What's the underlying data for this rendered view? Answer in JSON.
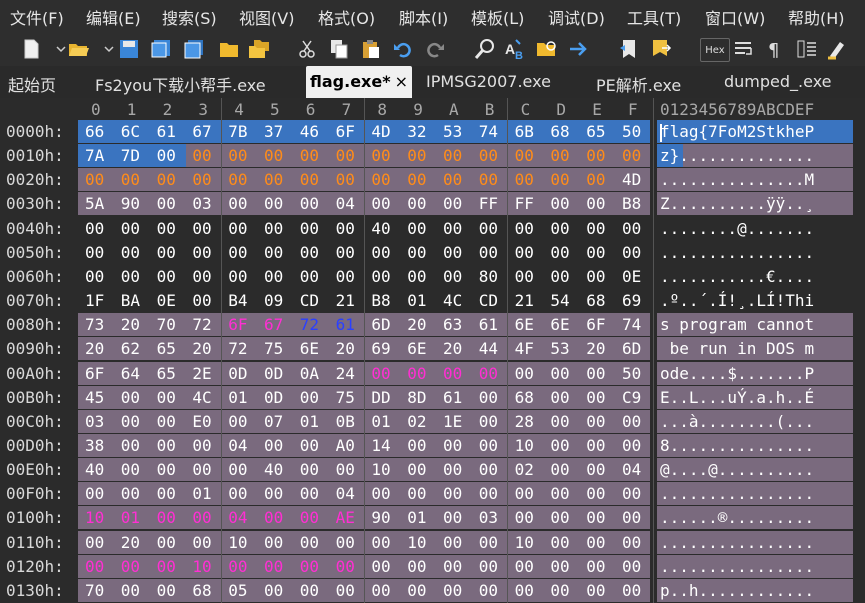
{
  "menu": [
    "文件(F)",
    "编辑(E)",
    "搜索(S)",
    "视图(V)",
    "格式(O)",
    "脚本(I)",
    "模板(L)",
    "调试(D)",
    "工具(T)",
    "窗口(W)",
    "帮助(H)"
  ],
  "toolbar": {
    "icons": [
      "new-file-icon",
      "dropdown-icon",
      "open-folder-icon",
      "dropdown-icon",
      "save-icon",
      "save-as-icon",
      "save-all-icon",
      "folder-icon",
      "folder-stack-icon",
      "cut-icon",
      "copy-icon",
      "paste-icon",
      "undo-icon",
      "redo-icon",
      "find-icon",
      "replace-icon",
      "find-in-files-icon",
      "goto-icon",
      "bookmark-icon",
      "bookmark-next-icon",
      "hex-mode-icon",
      "wrap-icon",
      "pilcrow-icon",
      "columns-icon",
      "highlight-icon"
    ],
    "hex_label": "Hex"
  },
  "tabs": [
    "起始页",
    "Fs2you下载小帮手.exe",
    "flag.exe*",
    "IPMSG2007.exe",
    "PE解析.exe",
    "dumped_.exe"
  ],
  "active_tab": 2,
  "close_glyph": "×",
  "column_header": {
    "hex": [
      "0",
      "1",
      "2",
      "3",
      "4",
      "5",
      "6",
      "7",
      "8",
      "9",
      "A",
      "B",
      "C",
      "D",
      "E",
      "F"
    ],
    "ascii": "0123456789ABCDEF"
  },
  "colors": {
    "selection": "#3a74c0",
    "struct": "#7a6a7e",
    "dark_row": "#2b2b2b",
    "zero_orange": "#ff8c1a",
    "magenta": "#ff2fd3",
    "blue": "#2a40ff",
    "white": "#ffffff"
  },
  "rows": [
    {
      "addr": "0000h:",
      "bytes": [
        "66",
        "6C",
        "61",
        "67",
        "7B",
        "37",
        "46",
        "6F",
        "4D",
        "32",
        "53",
        "74",
        "6B",
        "68",
        "65",
        "50"
      ],
      "ascii": "flag{7FoM2StkheP",
      "bg": "selection",
      "colors": {}
    },
    {
      "addr": "0010h:",
      "bytes": [
        "7A",
        "7D",
        "00",
        "00",
        "00",
        "00",
        "00",
        "00",
        "00",
        "00",
        "00",
        "00",
        "00",
        "00",
        "00",
        "00"
      ],
      "ascii": "z}..............",
      "bg": "mixed",
      "colors": {
        "3": "orange",
        "4": "orange",
        "5": "orange",
        "6": "orange",
        "7": "orange",
        "8": "orange",
        "9": "orange",
        "10": "orange",
        "11": "orange",
        "12": "orange",
        "13": "orange",
        "14": "orange",
        "15": "orange"
      }
    },
    {
      "addr": "0020h:",
      "bytes": [
        "00",
        "00",
        "00",
        "00",
        "00",
        "00",
        "00",
        "00",
        "00",
        "00",
        "00",
        "00",
        "00",
        "00",
        "00",
        "4D"
      ],
      "ascii": "...............M",
      "bg": "struct",
      "colors": {
        "0": "orange",
        "1": "orange",
        "2": "orange",
        "3": "orange",
        "4": "orange",
        "5": "orange",
        "6": "orange",
        "7": "orange",
        "8": "orange",
        "9": "orange",
        "10": "orange",
        "11": "orange",
        "12": "orange",
        "13": "orange",
        "14": "orange"
      }
    },
    {
      "addr": "0030h:",
      "bytes": [
        "5A",
        "90",
        "00",
        "03",
        "00",
        "00",
        "00",
        "04",
        "00",
        "00",
        "00",
        "FF",
        "FF",
        "00",
        "00",
        "B8"
      ],
      "ascii": "Z..........ÿÿ..¸",
      "bg": "struct",
      "colors": {}
    },
    {
      "addr": "0040h:",
      "bytes": [
        "00",
        "00",
        "00",
        "00",
        "00",
        "00",
        "00",
        "00",
        "40",
        "00",
        "00",
        "00",
        "00",
        "00",
        "00",
        "00"
      ],
      "ascii": "........@.......",
      "bg": "dark",
      "colors": {}
    },
    {
      "addr": "0050h:",
      "bytes": [
        "00",
        "00",
        "00",
        "00",
        "00",
        "00",
        "00",
        "00",
        "00",
        "00",
        "00",
        "00",
        "00",
        "00",
        "00",
        "00"
      ],
      "ascii": "................",
      "bg": "dark",
      "colors": {}
    },
    {
      "addr": "0060h:",
      "bytes": [
        "00",
        "00",
        "00",
        "00",
        "00",
        "00",
        "00",
        "00",
        "00",
        "00",
        "00",
        "80",
        "00",
        "00",
        "00",
        "0E"
      ],
      "ascii": "...........€....",
      "bg": "dark",
      "colors": {}
    },
    {
      "addr": "0070h:",
      "bytes": [
        "1F",
        "BA",
        "0E",
        "00",
        "B4",
        "09",
        "CD",
        "21",
        "B8",
        "01",
        "4C",
        "CD",
        "21",
        "54",
        "68",
        "69"
      ],
      "ascii": ".º..´.Í!¸.LÍ!Thi",
      "bg": "dark",
      "colors": {}
    },
    {
      "addr": "0080h:",
      "bytes": [
        "73",
        "20",
        "70",
        "72",
        "6F",
        "67",
        "72",
        "61",
        "6D",
        "20",
        "63",
        "61",
        "6E",
        "6E",
        "6F",
        "74"
      ],
      "ascii": "s program cannot",
      "bg": "struct",
      "colors": {
        "4": "magenta",
        "5": "magenta",
        "6": "blue",
        "7": "blue"
      }
    },
    {
      "addr": "0090h:",
      "bytes": [
        "20",
        "62",
        "65",
        "20",
        "72",
        "75",
        "6E",
        "20",
        "69",
        "6E",
        "20",
        "44",
        "4F",
        "53",
        "20",
        "6D"
      ],
      "ascii": " be run in DOS m",
      "bg": "struct",
      "colors": {}
    },
    {
      "addr": "00A0h:",
      "bytes": [
        "6F",
        "64",
        "65",
        "2E",
        "0D",
        "0D",
        "0A",
        "24",
        "00",
        "00",
        "00",
        "00",
        "00",
        "00",
        "00",
        "50"
      ],
      "ascii": "ode....$.......P",
      "bg": "struct",
      "colors": {
        "8": "magenta",
        "9": "magenta",
        "10": "magenta",
        "11": "magenta"
      }
    },
    {
      "addr": "00B0h:",
      "bytes": [
        "45",
        "00",
        "00",
        "4C",
        "01",
        "0D",
        "00",
        "75",
        "DD",
        "8D",
        "61",
        "00",
        "68",
        "00",
        "00",
        "C9"
      ],
      "ascii": "E..L...uÝ.a.h..É",
      "bg": "struct",
      "colors": {}
    },
    {
      "addr": "00C0h:",
      "bytes": [
        "03",
        "00",
        "00",
        "E0",
        "00",
        "07",
        "01",
        "0B",
        "01",
        "02",
        "1E",
        "00",
        "28",
        "00",
        "00",
        "00"
      ],
      "ascii": "...à........(...",
      "bg": "struct",
      "colors": {}
    },
    {
      "addr": "00D0h:",
      "bytes": [
        "38",
        "00",
        "00",
        "00",
        "04",
        "00",
        "00",
        "A0",
        "14",
        "00",
        "00",
        "00",
        "10",
        "00",
        "00",
        "00"
      ],
      "ascii": "8...............",
      "bg": "struct",
      "colors": {}
    },
    {
      "addr": "00E0h:",
      "bytes": [
        "40",
        "00",
        "00",
        "00",
        "00",
        "40",
        "00",
        "00",
        "10",
        "00",
        "00",
        "00",
        "02",
        "00",
        "00",
        "04"
      ],
      "ascii": "@....@..........",
      "bg": "struct",
      "colors": {}
    },
    {
      "addr": "00F0h:",
      "bytes": [
        "00",
        "00",
        "00",
        "01",
        "00",
        "00",
        "00",
        "04",
        "00",
        "00",
        "00",
        "00",
        "00",
        "00",
        "00",
        "00"
      ],
      "ascii": "................",
      "bg": "struct",
      "colors": {}
    },
    {
      "addr": "0100h:",
      "bytes": [
        "10",
        "01",
        "00",
        "00",
        "04",
        "00",
        "00",
        "AE",
        "90",
        "01",
        "00",
        "03",
        "00",
        "00",
        "00",
        "00"
      ],
      "ascii": "......®.........",
      "bg": "struct",
      "colors": {
        "0": "magenta",
        "1": "magenta",
        "2": "magenta",
        "3": "magenta",
        "4": "magenta",
        "5": "magenta",
        "6": "magenta",
        "7": "magenta"
      }
    },
    {
      "addr": "0110h:",
      "bytes": [
        "00",
        "20",
        "00",
        "00",
        "10",
        "00",
        "00",
        "00",
        "00",
        "10",
        "00",
        "00",
        "10",
        "00",
        "00",
        "00"
      ],
      "ascii": "................",
      "bg": "struct",
      "colors": {}
    },
    {
      "addr": "0120h:",
      "bytes": [
        "00",
        "00",
        "00",
        "10",
        "00",
        "00",
        "00",
        "00",
        "00",
        "00",
        "00",
        "00",
        "00",
        "00",
        "00",
        "00"
      ],
      "ascii": "................",
      "bg": "struct",
      "colors": {
        "0": "magenta",
        "1": "magenta",
        "2": "magenta",
        "3": "magenta",
        "4": "magenta",
        "5": "magenta",
        "6": "magenta",
        "7": "magenta"
      }
    },
    {
      "addr": "0130h:",
      "bytes": [
        "70",
        "00",
        "00",
        "68",
        "05",
        "00",
        "00",
        "00",
        "00",
        "00",
        "00",
        "00",
        "00",
        "00",
        "00",
        "00"
      ],
      "ascii": "p..h............",
      "bg": "struct",
      "colors": {}
    }
  ]
}
